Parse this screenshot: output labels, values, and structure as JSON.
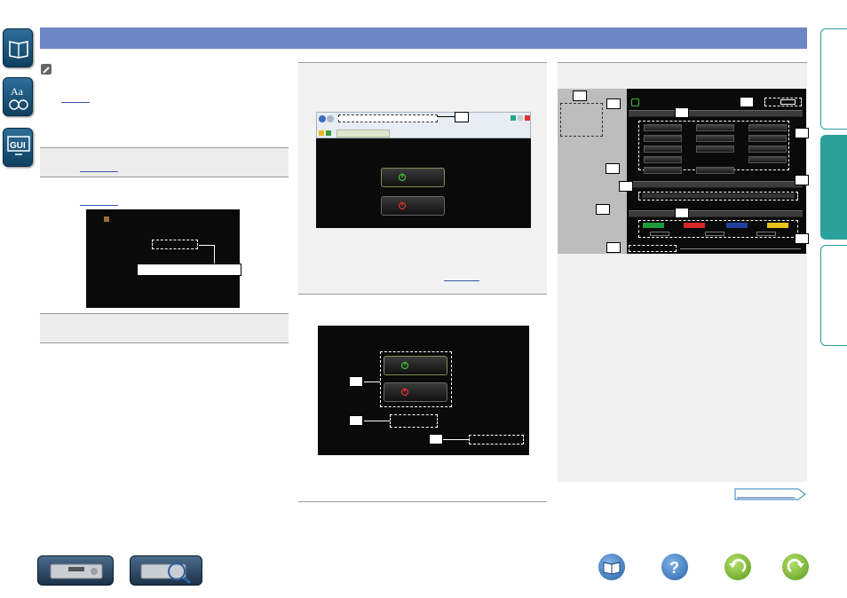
{
  "header": {
    "title": ""
  },
  "left_tabs": [
    {
      "name": "contents",
      "icon": "book-icon"
    },
    {
      "name": "index",
      "icon": "aa-index-icon"
    },
    {
      "name": "gui",
      "icon": "gui-icon",
      "label": "GUI"
    }
  ],
  "left_column": {
    "note_icon": "pencil-icon",
    "sample_screen": {
      "callout_text": ""
    }
  },
  "figures": {
    "browser_screen": {
      "callout": ""
    },
    "power_screen": {
      "callouts": [
        "",
        "",
        ""
      ]
    },
    "main_screen": {
      "callouts": [
        "",
        "",
        "",
        "",
        "",
        "",
        "",
        "",
        "",
        "",
        "",
        ""
      ]
    }
  },
  "colors": {
    "header_bar": "#6d86c6",
    "tab_accent": "#2aa19a",
    "link": "#3a56a8",
    "power_on": "#3cbf3c",
    "power_off": "#e03030",
    "key_green": "#1f9a3a",
    "key_red": "#d72828",
    "key_blue": "#2340a0",
    "key_yellow": "#e8c21a"
  },
  "bottom_nav": {
    "next_button_label": "",
    "icons": [
      "front-panel-icon",
      "remote-control-icon",
      "book-icon",
      "help-icon",
      "back-icon",
      "forward-icon"
    ]
  }
}
